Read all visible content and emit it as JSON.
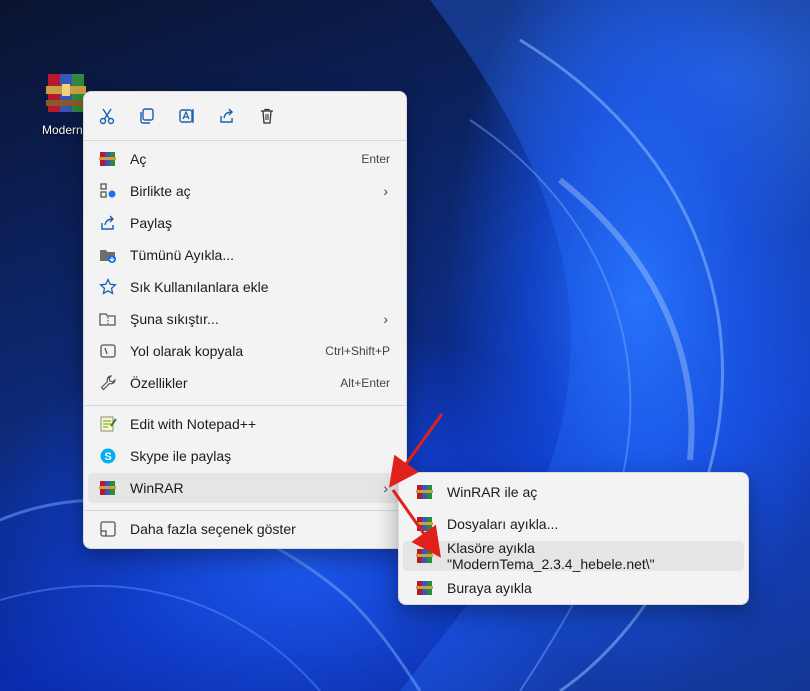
{
  "desktop": {
    "icon_label": "ModernTema"
  },
  "toolbar": [
    "cut-icon",
    "copy-icon",
    "rename-icon",
    "share-icon",
    "delete-icon"
  ],
  "menu": {
    "items": [
      {
        "label": "Aç",
        "shortcut": "Enter",
        "icon": "winrar-icon"
      },
      {
        "label": "Birlikte aç",
        "shortcut": "",
        "icon": "open-with-icon"
      },
      {
        "label": "Paylaş",
        "shortcut": "",
        "icon": "share-icon"
      },
      {
        "label": "Tümünü Ayıkla...",
        "shortcut": "",
        "icon": "extract-all-icon"
      },
      {
        "label": "Sık Kullanılanlara ekle",
        "shortcut": "",
        "icon": "star-icon"
      },
      {
        "label": "Şuna sıkıştır...",
        "shortcut": "",
        "icon": "compress-icon"
      },
      {
        "label": "Yol olarak kopyala",
        "shortcut": "Ctrl+Shift+P",
        "icon": "copy-path-icon"
      },
      {
        "label": "Özellikler",
        "shortcut": "Alt+Enter",
        "icon": "wrench-icon"
      },
      {
        "label": "Edit with Notepad++",
        "shortcut": "",
        "icon": "notepad-icon"
      },
      {
        "label": "Skype ile paylaş",
        "shortcut": "",
        "icon": "skype-icon"
      },
      {
        "label": "WinRAR",
        "shortcut": "",
        "icon": "winrar-icon"
      },
      {
        "label": "Daha fazla seçenek göster",
        "shortcut": "",
        "icon": "more-options-icon"
      }
    ]
  },
  "submenu": {
    "items": [
      {
        "label": "WinRAR ile aç"
      },
      {
        "label": "Dosyaları ayıkla..."
      },
      {
        "label": "Klasöre ayıkla \"ModernTema_2.3.4_hebele.net\\\""
      },
      {
        "label": "Buraya ayıkla"
      }
    ]
  },
  "colors": {
    "menu_bg": "#f3f3f3",
    "arrow": "#e0201b",
    "accent": "#0067c0"
  }
}
